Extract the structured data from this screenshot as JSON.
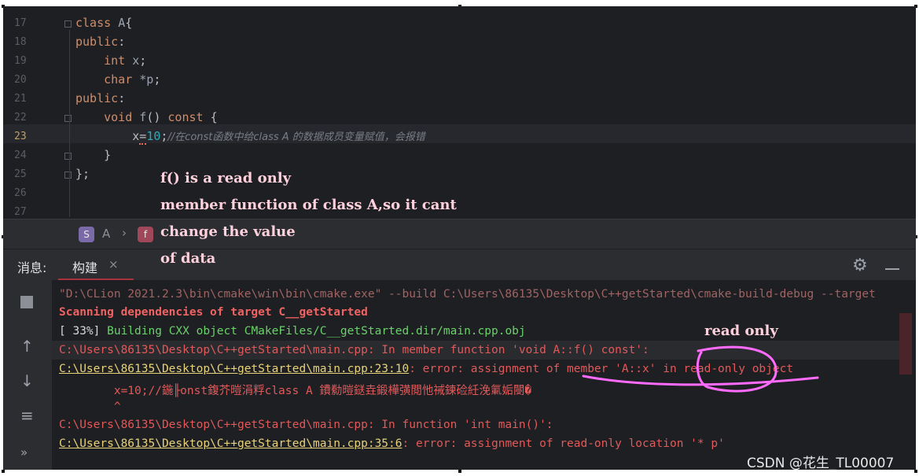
{
  "editor": {
    "line_numbers": [
      "17",
      "18",
      "19",
      "20",
      "21",
      "22",
      "23",
      "24",
      "25",
      "26",
      "27"
    ],
    "lines": {
      "l17": {
        "kw": "class",
        "name": "A",
        "rest": "{"
      },
      "l18": {
        "kw": "public",
        "rest": ":"
      },
      "l19": {
        "kw": "int",
        "name": "x",
        "rest": ";"
      },
      "l20": {
        "kw": "char",
        "rest": "*p",
        "end": ";"
      },
      "l21": {
        "kw": "public",
        "rest": ":"
      },
      "l22": {
        "kw": "void",
        "name": "f",
        "mid": "()",
        "kw2": "const",
        "rest": "{"
      },
      "l23": {
        "name": "x",
        "op": "=",
        "num": "10",
        "end": ";",
        "comment": "//在const函数中给class A 的数据成员变量赋值，会报错"
      },
      "l24": {
        "rest": "}"
      },
      "l25": {
        "rest": "};"
      }
    }
  },
  "annotation": {
    "line1": "f() is a read only",
    "line2": "member function of class A,so it cant",
    "line3": "change the value",
    "line4": "of data",
    "read_only_note": "read only"
  },
  "breadcrumb": {
    "class_badge": "S",
    "class_name": "A",
    "separator": "›",
    "func_badge": "f"
  },
  "toolwindow": {
    "messages_label": "消息:",
    "build_tab_label": "构建",
    "close": "×"
  },
  "output": {
    "cmd": "\"D:\\CLion 2021.2.3\\bin\\cmake\\win\\bin\\cmake.exe\" --build C:\\Users\\86135\\Desktop\\C++getStarted\\cmake-build-debug --target",
    "scan": "Scanning dependencies of target C__getStarted",
    "progress": "[ 33%]",
    "building": "Building CXX object CMakeFiles/C__getStarted.dir/main.cpp.obj",
    "member_fn": "C:\\Users\\86135\\Desktop\\C++getStarted\\main.cpp: In member function 'void A::f() const':",
    "err1_loc": "C:\\Users\\86135\\Desktop\\C++getStarted\\main.cpp:23:10",
    "err1_msg": ": error: assignment of member 'A::x' in read-only object",
    "garbled": "        x=10;//鍦╟onst鍑芥暟涓粰class A 鐨勬暟鎹垚鍛樺彉閲忚祴鍊硷紝浼氭姤閿�",
    "caret": "        ^",
    "in_main": "C:\\Users\\86135\\Desktop\\C++getStarted\\main.cpp: In function 'int main()':",
    "err2_loc": "C:\\Users\\86135\\Desktop\\C++getStarted\\main.cpp:35:6",
    "err2_msg": ": error: assignment of read-only location '* p'"
  },
  "sidebar_icons": [
    "stop-icon",
    "up-arrow-icon",
    "down-arrow-icon",
    "soft-wrap-icon",
    "more-icon"
  ],
  "watermark": "CSDN @花生_TL00007",
  "colors": {
    "annotation_pink": "#ffd1dc",
    "marker_magenta": "#ff6bff",
    "error_red": "#e1595a",
    "link_yellow": "#e8d27a",
    "success_green": "#6ad26a"
  }
}
